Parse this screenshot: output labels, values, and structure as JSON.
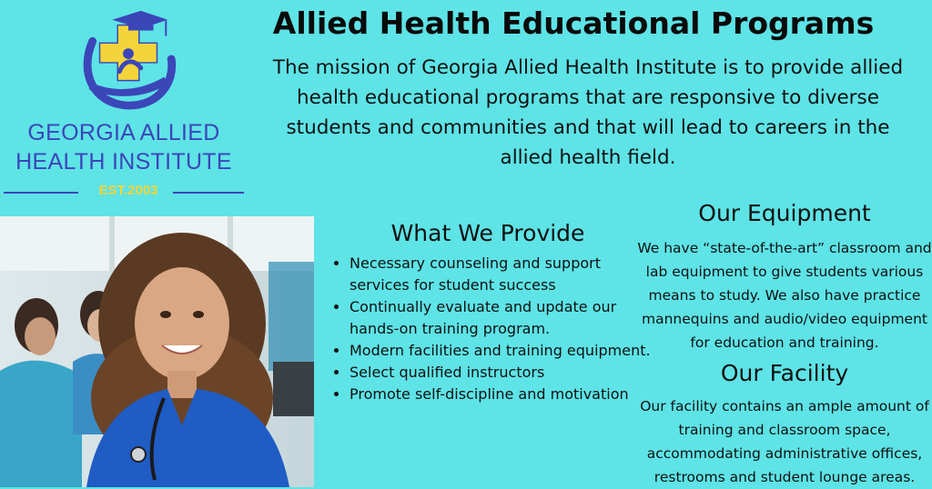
{
  "logo": {
    "line1": "GEORGIA ALLIED",
    "line2": "HEALTH INSTITUTE",
    "established": "EST.2003",
    "brand_color": "#3b46b8",
    "accent_color": "#f3d43a"
  },
  "title": "Allied Health Educational Programs",
  "mission": "The mission of Georgia Allied Health Institute is to provide allied health educational programs that are responsive to diverse students and communities and that will lead to careers in the allied health field.",
  "provide": {
    "heading": "What We Provide",
    "items": [
      "Necessary counseling and support services for student success",
      "Continually evaluate and update our hands-on training program.",
      "Modern facilities and training equipment.",
      "Select qualified instructors",
      "Promote self-discipline and motivation"
    ]
  },
  "equipment": {
    "heading": "Our Equipment",
    "text": "We have “state-of-the-art” classroom and lab equipment to give students various means to study. We also have practice mannequins and audio/video equipment for education and training."
  },
  "facility": {
    "heading": "Our Facility",
    "text": "Our facility contains an ample amount of training and classroom space, accommodating administrative offices, restrooms and student lounge areas."
  },
  "colors": {
    "background": "#5ee3e6",
    "scrubs": "#1f5cc4"
  }
}
